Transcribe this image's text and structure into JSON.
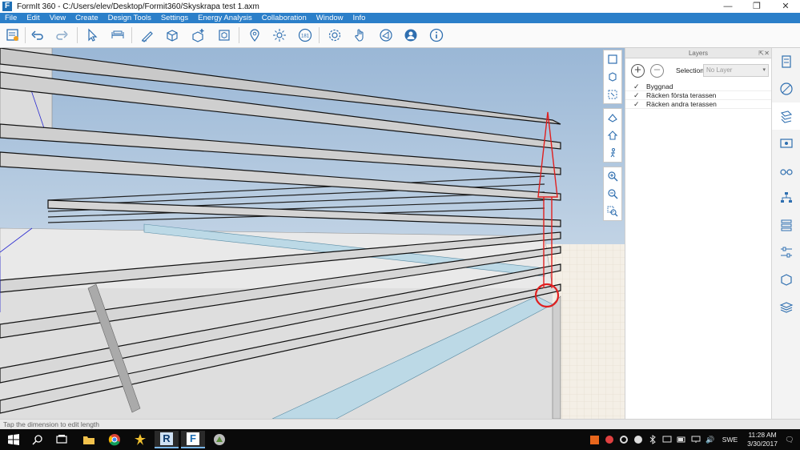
{
  "window": {
    "title": "FormIt 360 - C:/Users/elev/Desktop/Formit360/Skyskrapa test 1.axm",
    "logo_letter": "F",
    "controls": {
      "minimize": "—",
      "maximize": "❐",
      "close": "✕"
    }
  },
  "menu": {
    "items": [
      "File",
      "Edit",
      "View",
      "Create",
      "Design Tools",
      "Settings",
      "Energy Analysis",
      "Collaboration",
      "Window",
      "Info"
    ]
  },
  "toolbar": {
    "tools": [
      "project-properties-icon",
      "undo-icon",
      "redo-icon",
      "select-icon",
      "dimension-icon",
      "sketch-pen-icon",
      "cube-icon",
      "add-solid-icon",
      "group-icon",
      "location-pin-icon",
      "sun-icon",
      "level-icon",
      "settings-gear-icon",
      "hand-touch-icon",
      "share-icon",
      "user-icon",
      "info-icon"
    ],
    "level_badge": "181"
  },
  "view_tools": {
    "groups": [
      [
        "zoom-extents-icon",
        "orbit-icon",
        "zoom-selected-icon"
      ],
      [
        "view-cube-icon",
        "home-view-icon",
        "walk-icon"
      ],
      [
        "zoom-in-icon",
        "zoom-out-icon",
        "zoom-window-icon"
      ]
    ]
  },
  "layers_panel": {
    "title": "Layers",
    "pin": "⇱",
    "close": "✕",
    "add_label": "+",
    "remove_label": "−",
    "selection_label": "Selection:",
    "selection_value": "No Layer",
    "rows": [
      {
        "name": "Byggnad",
        "check": "✓"
      },
      {
        "name": "Räcken första terassen",
        "check": "✓"
      },
      {
        "name": "Räcken andra terassen",
        "check": "✓"
      }
    ]
  },
  "right_strip": {
    "items": [
      "properties-icon",
      "materials-icon",
      "layers-icon",
      "scenes-icon",
      "visual-styles-icon",
      "groups-tree-icon",
      "levels-icon",
      "sliders-icon",
      "components-icon",
      "stack-icon"
    ],
    "active_index": 2
  },
  "status": {
    "text": "Tap the dimension to edit length"
  },
  "taskbar": {
    "apps": [
      "start-icon",
      "search-icon",
      "task-view-icon",
      "file-explorer-icon",
      "chrome-icon",
      "app-figure-icon",
      "revit-icon",
      "formit-icon",
      "app-parrot-icon"
    ],
    "revit_letter": "R",
    "formit_letter": "F",
    "lang": "SWE",
    "time": "11:28 AM",
    "date": "3/30/2017",
    "tray_speaker": "🔊",
    "tray_notify": "🗨"
  },
  "colors": {
    "menubar": "#2b7fc9",
    "sky_top": "#9ab7d6",
    "sky_bottom": "#e4ecf2",
    "dimension_red": "#e02020",
    "glass_blue": "#bcd9e6"
  }
}
